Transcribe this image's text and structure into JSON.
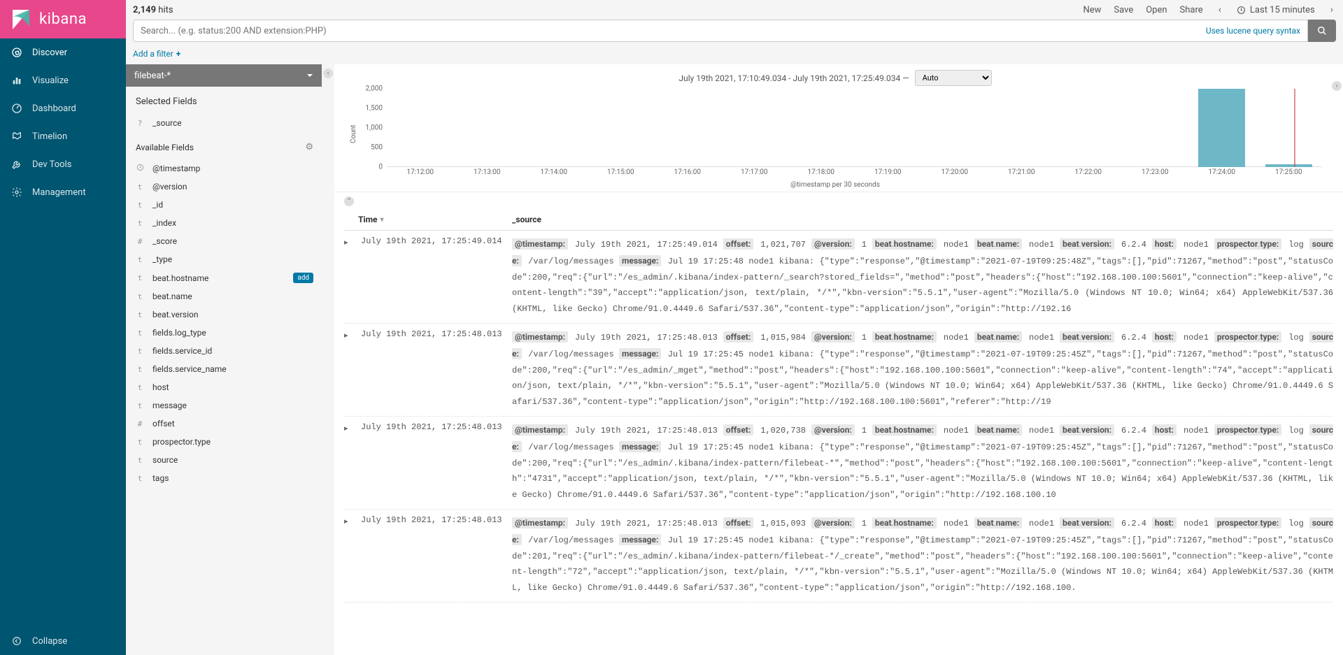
{
  "brand": {
    "name": "kibana"
  },
  "nav": {
    "items": [
      {
        "id": "discover",
        "label": "Discover"
      },
      {
        "id": "visualize",
        "label": "Visualize"
      },
      {
        "id": "dashboard",
        "label": "Dashboard"
      },
      {
        "id": "timelion",
        "label": "Timelion"
      },
      {
        "id": "devtools",
        "label": "Dev Tools"
      },
      {
        "id": "management",
        "label": "Management"
      }
    ],
    "collapse": "Collapse"
  },
  "top": {
    "hits_count": "2,149",
    "hits_label": "hits",
    "actions": [
      "New",
      "Save",
      "Open",
      "Share"
    ],
    "time_range": "Last 15 minutes"
  },
  "search": {
    "placeholder": "Search... (e.g. status:200 AND extension:PHP)",
    "lucene": "Uses lucene query syntax",
    "add_filter": "Add a filter"
  },
  "index_pattern": "filebeat-*",
  "fields": {
    "selected_title": "Selected Fields",
    "selected": [
      {
        "type": "?",
        "name": "_source"
      }
    ],
    "available_title": "Available Fields",
    "available": [
      {
        "type": "clock",
        "name": "@timestamp"
      },
      {
        "type": "t",
        "name": "@version"
      },
      {
        "type": "t",
        "name": "_id"
      },
      {
        "type": "t",
        "name": "_index"
      },
      {
        "type": "#",
        "name": "_score"
      },
      {
        "type": "t",
        "name": "_type"
      },
      {
        "type": "t",
        "name": "beat.hostname",
        "add": true
      },
      {
        "type": "t",
        "name": "beat.name"
      },
      {
        "type": "t",
        "name": "beat.version"
      },
      {
        "type": "t",
        "name": "fields.log_type"
      },
      {
        "type": "t",
        "name": "fields.service_id"
      },
      {
        "type": "t",
        "name": "fields.service_name"
      },
      {
        "type": "t",
        "name": "host"
      },
      {
        "type": "t",
        "name": "message"
      },
      {
        "type": "#",
        "name": "offset"
      },
      {
        "type": "t",
        "name": "prospector.type"
      },
      {
        "type": "t",
        "name": "source"
      },
      {
        "type": "t",
        "name": "tags"
      }
    ],
    "add_label": "add"
  },
  "chart_data": {
    "type": "bar",
    "title_range": "July 19th 2021, 17:10:49.034 - July 19th 2021, 17:25:49.034 —",
    "interval_selected": "Auto",
    "xlabel": "@timestamp per 30 seconds",
    "ylabel": "Count",
    "ylim": [
      0,
      2000
    ],
    "yticks": [
      0,
      500,
      1000,
      1500,
      2000
    ],
    "categories": [
      "17:12:00",
      "17:13:00",
      "17:14:00",
      "17:15:00",
      "17:16:00",
      "17:17:00",
      "17:18:00",
      "17:19:00",
      "17:20:00",
      "17:21:00",
      "17:22:00",
      "17:23:00",
      "17:24:00",
      "17:25:00"
    ],
    "values": [
      0,
      0,
      0,
      0,
      0,
      0,
      0,
      0,
      0,
      0,
      0,
      0,
      2100,
      80
    ]
  },
  "table": {
    "headers": {
      "time": "Time",
      "source": "_source"
    },
    "rows": [
      {
        "time": "July 19th 2021, 17:25:49.014",
        "kv": [
          [
            "@timestamp",
            "July 19th 2021, 17:25:49.014"
          ],
          [
            "offset",
            "1,021,707"
          ],
          [
            "@version",
            "1"
          ],
          [
            "beat.hostname",
            "node1"
          ],
          [
            "beat.name",
            "node1"
          ],
          [
            "beat.version",
            "6.2.4"
          ],
          [
            "host",
            "node1"
          ],
          [
            "prospector.type",
            "log"
          ],
          [
            "source",
            "/var/log/messages"
          ],
          [
            "message",
            "Jul 19 17:25:48 node1 kibana: {\"type\":\"response\",\"@timestamp\":\"2021-07-19T09:25:48Z\",\"tags\":[],\"pid\":71267,\"method\":\"post\",\"statusCode\":200,\"req\":{\"url\":\"/es_admin/.kibana/index-pattern/_search?stored_fields=\",\"method\":\"post\",\"headers\":{\"host\":\"192.168.100.100:5601\",\"connection\":\"keep-alive\",\"content-length\":\"39\",\"accept\":\"application/json, text/plain, */*\",\"kbn-version\":\"5.5.1\",\"user-agent\":\"Mozilla/5.0 (Windows NT 10.0; Win64; x64) AppleWebKit/537.36 (KHTML, like Gecko) Chrome/91.0.4449.6 Safari/537.36\",\"content-type\":\"application/json\",\"origin\":\"http://192.16"
          ]
        ]
      },
      {
        "time": "July 19th 2021, 17:25:48.013",
        "kv": [
          [
            "@timestamp",
            "July 19th 2021, 17:25:48.013"
          ],
          [
            "offset",
            "1,015,984"
          ],
          [
            "@version",
            "1"
          ],
          [
            "beat.hostname",
            "node1"
          ],
          [
            "beat.name",
            "node1"
          ],
          [
            "beat.version",
            "6.2.4"
          ],
          [
            "host",
            "node1"
          ],
          [
            "prospector.type",
            "log"
          ],
          [
            "source",
            "/var/log/messages"
          ],
          [
            "message",
            "Jul 19 17:25:45 node1 kibana: {\"type\":\"response\",\"@timestamp\":\"2021-07-19T09:25:45Z\",\"tags\":[],\"pid\":71267,\"method\":\"post\",\"statusCode\":200,\"req\":{\"url\":\"/es_admin/_mget\",\"method\":\"post\",\"headers\":{\"host\":\"192.168.100.100:5601\",\"connection\":\"keep-alive\",\"content-length\":\"74\",\"accept\":\"application/json, text/plain, */*\",\"kbn-version\":\"5.5.1\",\"user-agent\":\"Mozilla/5.0 (Windows NT 10.0; Win64; x64) AppleWebKit/537.36 (KHTML, like Gecko) Chrome/91.0.4449.6 Safari/537.36\",\"content-type\":\"application/json\",\"origin\":\"http://192.168.100.100:5601\",\"referer\":\"http://19"
          ]
        ]
      },
      {
        "time": "July 19th 2021, 17:25:48.013",
        "kv": [
          [
            "@timestamp",
            "July 19th 2021, 17:25:48.013"
          ],
          [
            "offset",
            "1,020,738"
          ],
          [
            "@version",
            "1"
          ],
          [
            "beat.hostname",
            "node1"
          ],
          [
            "beat.name",
            "node1"
          ],
          [
            "beat.version",
            "6.2.4"
          ],
          [
            "host",
            "node1"
          ],
          [
            "prospector.type",
            "log"
          ],
          [
            "source",
            "/var/log/messages"
          ],
          [
            "message",
            "Jul 19 17:25:45 node1 kibana: {\"type\":\"response\",\"@timestamp\":\"2021-07-19T09:25:45Z\",\"tags\":[],\"pid\":71267,\"method\":\"post\",\"statusCode\":200,\"req\":{\"url\":\"/es_admin/.kibana/index-pattern/filebeat-*\",\"method\":\"post\",\"headers\":{\"host\":\"192.168.100.100:5601\",\"connection\":\"keep-alive\",\"content-length\":\"4731\",\"accept\":\"application/json, text/plain, */*\",\"kbn-version\":\"5.5.1\",\"user-agent\":\"Mozilla/5.0 (Windows NT 10.0; Win64; x64) AppleWebKit/537.36 (KHTML, like Gecko) Chrome/91.0.4449.6 Safari/537.36\",\"content-type\":\"application/json\",\"origin\":\"http://192.168.100.10"
          ]
        ]
      },
      {
        "time": "July 19th 2021, 17:25:48.013",
        "kv": [
          [
            "@timestamp",
            "July 19th 2021, 17:25:48.013"
          ],
          [
            "offset",
            "1,015,093"
          ],
          [
            "@version",
            "1"
          ],
          [
            "beat.hostname",
            "node1"
          ],
          [
            "beat.name",
            "node1"
          ],
          [
            "beat.version",
            "6.2.4"
          ],
          [
            "host",
            "node1"
          ],
          [
            "prospector.type",
            "log"
          ],
          [
            "source",
            "/var/log/messages"
          ],
          [
            "message",
            "Jul 19 17:25:45 node1 kibana: {\"type\":\"response\",\"@timestamp\":\"2021-07-19T09:25:45Z\",\"tags\":[],\"pid\":71267,\"method\":\"post\",\"statusCode\":201,\"req\":{\"url\":\"/es_admin/.kibana/index-pattern/filebeat-*/_create\",\"method\":\"post\",\"headers\":{\"host\":\"192.168.100.100:5601\",\"connection\":\"keep-alive\",\"content-length\":\"72\",\"accept\":\"application/json, text/plain, */*\",\"kbn-version\":\"5.5.1\",\"user-agent\":\"Mozilla/5.0 (Windows NT 10.0; Win64; x64) AppleWebKit/537.36 (KHTML, like Gecko) Chrome/91.0.4449.6 Safari/537.36\",\"content-type\":\"application/json\",\"origin\":\"http://192.168.100."
          ]
        ]
      }
    ]
  }
}
